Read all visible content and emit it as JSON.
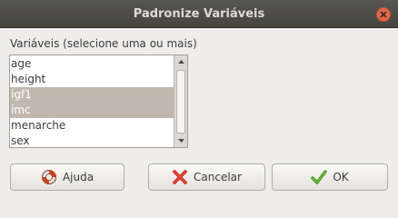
{
  "window": {
    "title": "Padronize Variáveis"
  },
  "list": {
    "label": "Variáveis (selecione uma ou mais)",
    "items": [
      {
        "label": "age",
        "selected": false
      },
      {
        "label": "height",
        "selected": false
      },
      {
        "label": "igf1",
        "selected": true
      },
      {
        "label": "imc",
        "selected": true
      },
      {
        "label": "menarche",
        "selected": false
      },
      {
        "label": "sex",
        "selected": false
      }
    ]
  },
  "buttons": {
    "help_label": "Ajuda",
    "cancel_label": "Cancelar",
    "ok_label": "OK"
  },
  "icons": {
    "help": "lifebuoy-icon",
    "cancel": "red-x-icon",
    "ok": "green-check-icon"
  },
  "colors": {
    "selection": "#c0b8ae",
    "titlebar": "#4f4e49",
    "close": "#e4674a"
  }
}
